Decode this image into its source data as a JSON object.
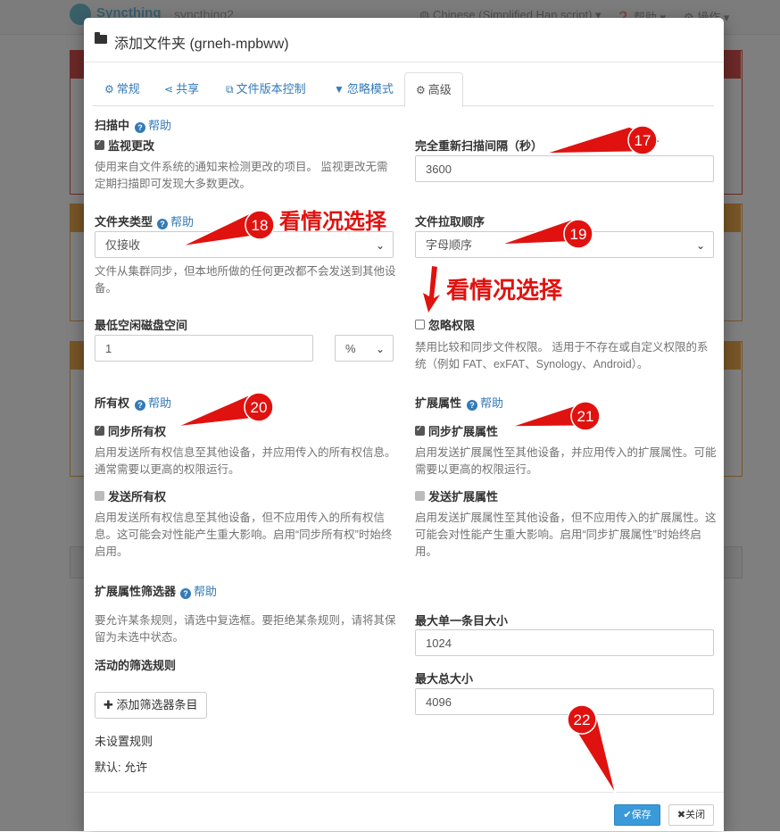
{
  "background": {
    "logo": "Syncthing",
    "device": "syncthing2",
    "language": "Chinese (Simplified Han script)",
    "help": "帮助",
    "actions": "操作"
  },
  "modal": {
    "title": "添加文件夹 (grneh-mpbww)",
    "tabs": [
      {
        "label": "常规",
        "icon": "gear-icon"
      },
      {
        "label": "共享",
        "icon": "share-icon"
      },
      {
        "label": "文件版本控制",
        "icon": "copy-icon"
      },
      {
        "label": "忽略模式",
        "icon": "filter-icon"
      },
      {
        "label": "高级",
        "icon": "cogs-icon"
      }
    ],
    "help_label": "帮助",
    "scanning": {
      "label": "扫描中",
      "watch_label": "监视更改",
      "watch_checked": true,
      "watch_desc": "使用来自文件系统的通知来检测更改的项目。 监视更改无需定期扫描即可发现大多数更改。"
    },
    "rescan": {
      "label": "完全重新扫描间隔（秒）",
      "value": "3600"
    },
    "folder_type": {
      "label": "文件夹类型",
      "value": "仅接收",
      "desc": "文件从集群同步，但本地所做的任何更改都不会发送到其他设备。"
    },
    "pull_order": {
      "label": "文件拉取顺序",
      "value": "字母顺序"
    },
    "min_disk": {
      "label": "最低空闲磁盘空间",
      "value": "1",
      "unit": "%"
    },
    "ignore_perms": {
      "label": "忽略权限",
      "checked": false,
      "desc": "禁用比较和同步文件权限。 适用于不存在或自定义权限的系统（例如 FAT、exFAT、Synology、Android）。"
    },
    "ownership": {
      "label": "所有权",
      "sync_label": "同步所有权",
      "sync_checked": true,
      "sync_desc": "启用发送所有权信息至其他设备，并应用传入的所有权信息。通常需要以更高的权限运行。",
      "send_label": "发送所有权",
      "send_desc": "启用发送所有权信息至其他设备，但不应用传入的所有权信息。这可能会对性能产生重大影响。启用“同步所有权”时始终启用。"
    },
    "xattrs": {
      "label": "扩展属性",
      "sync_label": "同步扩展属性",
      "sync_checked": true,
      "sync_desc": "启用发送扩展属性至其他设备，并应用传入的扩展属性。可能需要以更高的权限运行。",
      "send_label": "发送扩展属性",
      "send_desc": "启用发送扩展属性至其他设备，但不应用传入的扩展属性。这可能会对性能产生重大影响。启用“同步扩展属性”时始终启用。"
    },
    "xattr_filter": {
      "label": "扩展属性筛选器",
      "desc": "要允许某条规则，请选中复选框。要拒绝某条规则，请将其保留为未选中状态。",
      "active_label": "活动的筛选规则",
      "add_button": "添加筛选器条目",
      "no_rules": "未设置规则",
      "default": "默认: 允许"
    },
    "max_single": {
      "label": "最大单一条目大小",
      "value": "1024"
    },
    "max_total": {
      "label": "最大总大小",
      "value": "4096"
    },
    "footer": {
      "save": "保存",
      "close": "关闭"
    }
  },
  "annotations": {
    "note1": "看情况选择",
    "note2": "看情况选择",
    "markers": [
      "17",
      "18",
      "19",
      "20",
      "21",
      "22"
    ],
    "color": "#e0120f"
  }
}
